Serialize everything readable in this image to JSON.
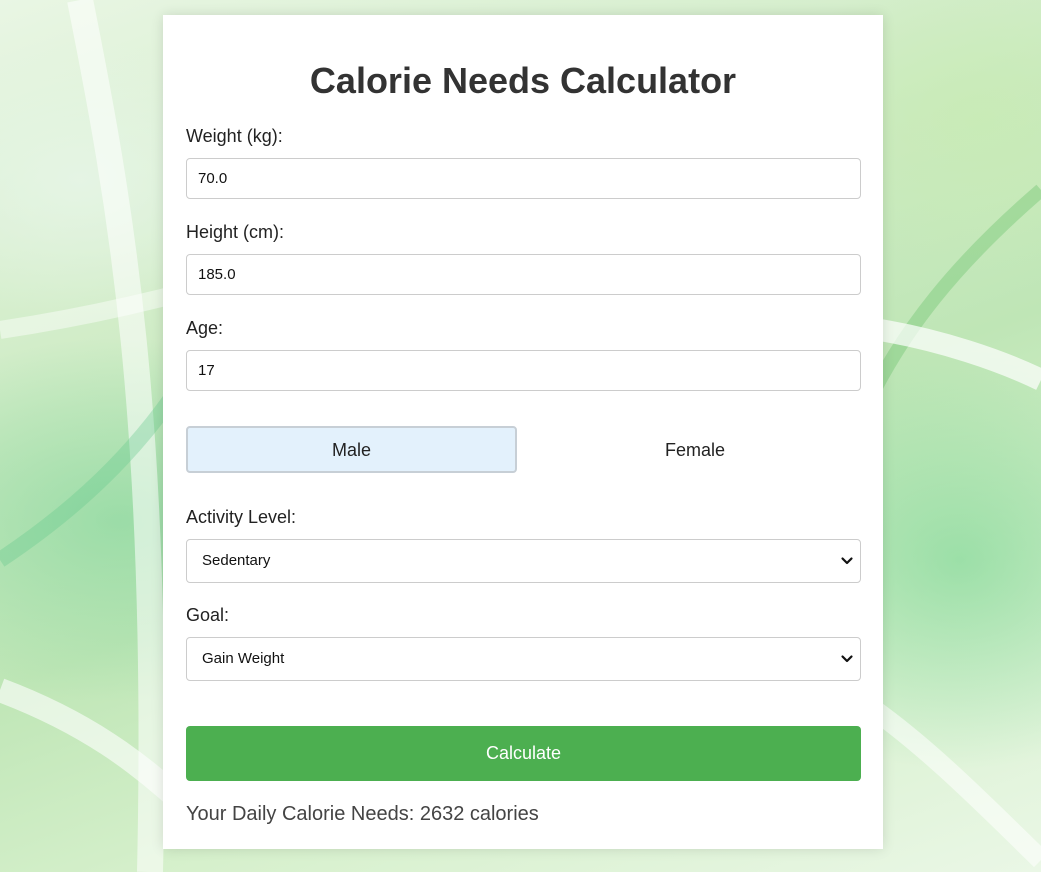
{
  "page": {
    "title": "Calorie Needs Calculator"
  },
  "form": {
    "weight": {
      "label": "Weight (kg):",
      "value": "70.0"
    },
    "height": {
      "label": "Height (cm):",
      "value": "185.0"
    },
    "age": {
      "label": "Age:",
      "value": "17"
    },
    "gender": {
      "options": [
        "Male",
        "Female"
      ],
      "selected": "Male"
    },
    "activity": {
      "label": "Activity Level:",
      "selected": "Sedentary"
    },
    "goal": {
      "label": "Goal:",
      "selected": "Gain Weight"
    },
    "calculate_label": "Calculate"
  },
  "result": {
    "text": "Your Daily Calorie Needs: 2632 calories"
  },
  "colors": {
    "accent": "#4caf50",
    "selected_gender_bg": "#e3f1fc",
    "title": "#333333"
  }
}
